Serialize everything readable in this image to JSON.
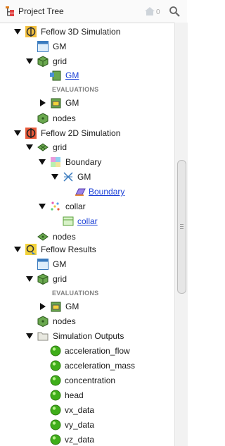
{
  "header": {
    "title": "Project Tree",
    "home_count": "0"
  },
  "tree": {
    "feflow3d": {
      "label": "Feflow 3D Simulation",
      "gm": "GM",
      "grid": "grid",
      "grid_gm_link": "GM",
      "evaluations": "EVALUATIONS",
      "eval_gm": "GM",
      "nodes": "nodes"
    },
    "feflow2d": {
      "label": "Feflow 2D Simulation",
      "grid": "grid",
      "boundary": "Boundary",
      "boundary_gm": "GM",
      "boundary_link": "Boundary",
      "collar": "collar",
      "collar_link": "collar",
      "nodes": "nodes"
    },
    "results": {
      "label": "Feflow Results",
      "gm": "GM",
      "grid": "grid",
      "evaluations": "EVALUATIONS",
      "eval_gm": "GM",
      "nodes": "nodes",
      "outputs": {
        "label": "Simulation Outputs",
        "items": [
          "acceleration_flow",
          "acceleration_mass",
          "concentration",
          "head",
          "vx_data",
          "vy_data",
          "vz_data"
        ]
      }
    }
  },
  "colors": {
    "link": "#1a3fd6",
    "section": "#808080",
    "output_ball": "#3fae1a"
  },
  "icons": {
    "toggle_expanded": "triangle-down-icon",
    "toggle_collapsed": "triangle-right-icon",
    "simulation_3d": "feflow-3d-icon",
    "simulation_2d": "feflow-2d-icon",
    "results": "feflow-results-icon",
    "gm": "geological-model-icon",
    "grid": "grid-cube-icon",
    "points": "points-icon",
    "surface": "surface-icon",
    "folder": "folder-icon",
    "output": "green-ball-icon"
  }
}
